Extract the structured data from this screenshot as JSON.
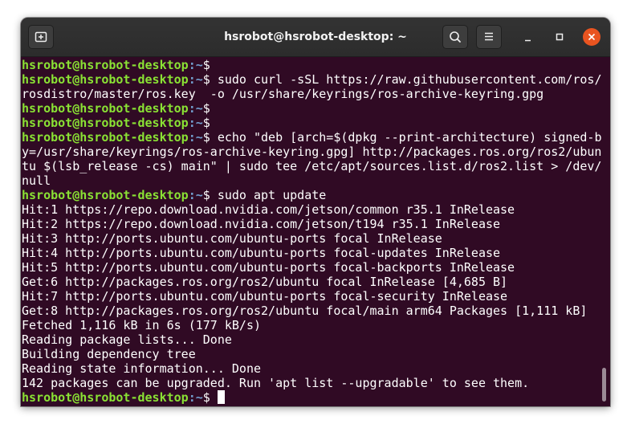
{
  "window": {
    "title": "hsrobot@hsrobot-desktop: ~",
    "icons": {
      "new_tab": "new-tab-icon",
      "search": "search-icon",
      "menu": "hamburger-menu-icon",
      "minimize": "minimize-icon",
      "maximize": "maximize-icon",
      "close": "close-icon"
    }
  },
  "colors": {
    "terminal_background": "#300a24",
    "prompt_user": "#8ae234",
    "prompt_path": "#729fcf",
    "text": "#ffffff",
    "close_button": "#e95420"
  },
  "prompt": {
    "user_host": "hsrobot@hsrobot-desktop",
    "path": ":~",
    "symbol": "$"
  },
  "terminal": {
    "lines": [
      {
        "type": "prompt",
        "command": ""
      },
      {
        "type": "prompt",
        "command": " sudo curl -sSL https://raw.githubusercontent.com/ros/"
      },
      {
        "type": "output",
        "text": "rosdistro/master/ros.key  -o /usr/share/keyrings/ros-archive-keyring.gpg"
      },
      {
        "type": "prompt",
        "command": ""
      },
      {
        "type": "prompt",
        "command": ""
      },
      {
        "type": "prompt",
        "command": " echo \"deb [arch=$(dpkg --print-architecture) signed-b"
      },
      {
        "type": "output",
        "text": "y=/usr/share/keyrings/ros-archive-keyring.gpg] http://packages.ros.org/ros2/ubun"
      },
      {
        "type": "output",
        "text": "tu $(lsb_release -cs) main\" | sudo tee /etc/apt/sources.list.d/ros2.list > /dev/"
      },
      {
        "type": "output",
        "text": "null"
      },
      {
        "type": "prompt",
        "command": " sudo apt update"
      },
      {
        "type": "output",
        "text": "Hit:1 https://repo.download.nvidia.com/jetson/common r35.1 InRelease"
      },
      {
        "type": "output",
        "text": "Hit:2 https://repo.download.nvidia.com/jetson/t194 r35.1 InRelease"
      },
      {
        "type": "output",
        "text": "Hit:3 http://ports.ubuntu.com/ubuntu-ports focal InRelease"
      },
      {
        "type": "output",
        "text": "Hit:4 http://ports.ubuntu.com/ubuntu-ports focal-updates InRelease"
      },
      {
        "type": "output",
        "text": "Hit:5 http://ports.ubuntu.com/ubuntu-ports focal-backports InRelease"
      },
      {
        "type": "output",
        "text": "Get:6 http://packages.ros.org/ros2/ubuntu focal InRelease [4,685 B]"
      },
      {
        "type": "output",
        "text": "Hit:7 http://ports.ubuntu.com/ubuntu-ports focal-security InRelease"
      },
      {
        "type": "output",
        "text": "Get:8 http://packages.ros.org/ros2/ubuntu focal/main arm64 Packages [1,111 kB]"
      },
      {
        "type": "output",
        "text": "Fetched 1,116 kB in 6s (177 kB/s)"
      },
      {
        "type": "output",
        "text": "Reading package lists... Done"
      },
      {
        "type": "output",
        "text": "Building dependency tree"
      },
      {
        "type": "output",
        "text": "Reading state information... Done"
      },
      {
        "type": "output",
        "text": "142 packages can be upgraded. Run 'apt list --upgradable' to see them."
      },
      {
        "type": "prompt",
        "command": " ",
        "cursor": true
      }
    ]
  }
}
